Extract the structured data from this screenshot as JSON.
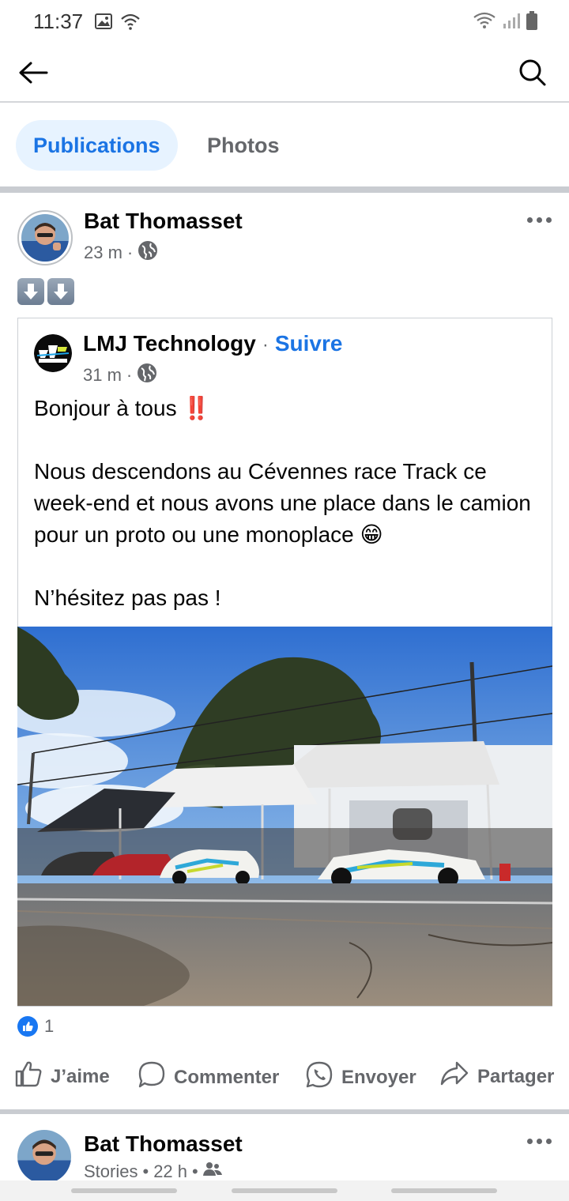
{
  "status_bar": {
    "time": "11:37",
    "icons_left": [
      "image-icon",
      "wifi-call-icon"
    ],
    "icons_right": [
      "wifi-icon",
      "signal-icon",
      "battery-icon"
    ]
  },
  "top_bar": {
    "back_icon": "arrow-left-icon",
    "search_icon": "search-icon"
  },
  "tabs": [
    {
      "label": "Publications",
      "active": true
    },
    {
      "label": "Photos",
      "active": false
    }
  ],
  "post": {
    "author": "Bat Thomasset",
    "time": "23 m",
    "separator": "·",
    "privacy_icon": "globe-icon",
    "emoji_line": [
      "down-arrow-emoji",
      "down-arrow-emoji"
    ],
    "shared": {
      "author": "LMJ Technology",
      "follow_separator": "·",
      "follow_label": "Suivre",
      "time": "31 m",
      "separator": "·",
      "privacy_icon": "globe-icon",
      "text": {
        "line1": "Bonjour à tous",
        "line1_emoji": "‼️",
        "line2": "Nous descendons au Cévennes race Track ce week-end et nous avons une place dans le camion pour un proto ou une monoplace",
        "line2_emoji": "😁",
        "line3": "N’hésitez pas pas !"
      },
      "photo_alt": "race-cars-under-tents-photo"
    },
    "reaction_count": "1",
    "actions": {
      "like": "J’aime",
      "comment": "Commenter",
      "send": "Envoyer",
      "share": "Partager"
    }
  },
  "post2": {
    "author": "Bat Thomasset",
    "meta_prefix": "Stories",
    "separator": "•",
    "time": "22 h",
    "separator2": "•",
    "audience_icon": "friends-icon"
  },
  "colors": {
    "accent": "#1b74e4",
    "tab_active_bg": "#e7f3ff",
    "secondary_text": "#65676b",
    "divider": "#c9ccd1"
  }
}
